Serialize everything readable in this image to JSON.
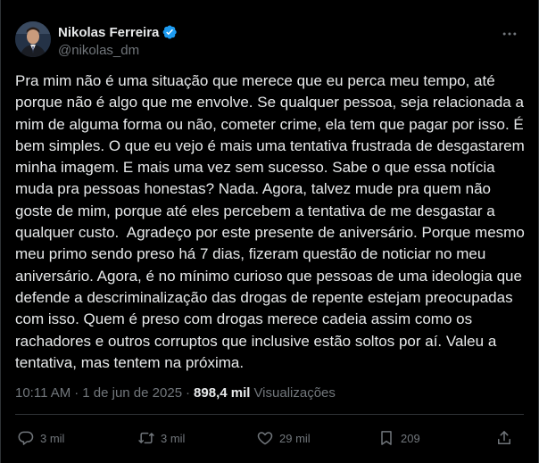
{
  "author": {
    "display_name": "Nikolas Ferreira",
    "handle": "@nikolas_dm",
    "verified_color": "#1d9bf0"
  },
  "tweet": {
    "text": "Pra mim não é uma situação que merece que eu perca meu tempo, até porque não é algo que me envolve. Se qualquer pessoa, seja relacionada a mim de alguma forma ou não, cometer crime, ela tem que pagar por isso. É bem simples. O que eu vejo é mais uma tentativa frustrada de desgastarem minha imagem. E mais uma vez sem sucesso. Sabe o que essa notícia muda pra pessoas honestas? Nada. Agora, talvez mude pra quem não goste de mim, porque até eles percebem a tentativa de me desgastar a qualquer custo.  Agradeço por este presente de aniversário. Porque mesmo meu primo sendo preso há 7 dias, fizeram questão de noticiar no meu aniversário. Agora, é no mínimo curioso que pessoas de uma ideologia que defende a descriminalização das drogas de repente estejam preocupadas com isso. Quem é preso com drogas merece cadeia assim como os rachadores e outros corruptos que inclusive estão soltos por aí. Valeu a tentativa, mas tentem na próxima.",
    "time": "10:11 AM",
    "separator": "·",
    "date": "1 de jun de 2025",
    "views_count": "898,4 mil",
    "views_label": "Visualizações"
  },
  "actions": {
    "replies": "3 mil",
    "reposts": "3 mil",
    "likes": "29 mil",
    "bookmarks": "209"
  },
  "icons": {
    "more": "more-dots-icon",
    "reply": "reply-icon",
    "repost": "repost-icon",
    "like": "heart-icon",
    "bookmark": "bookmark-icon",
    "share": "share-icon"
  }
}
